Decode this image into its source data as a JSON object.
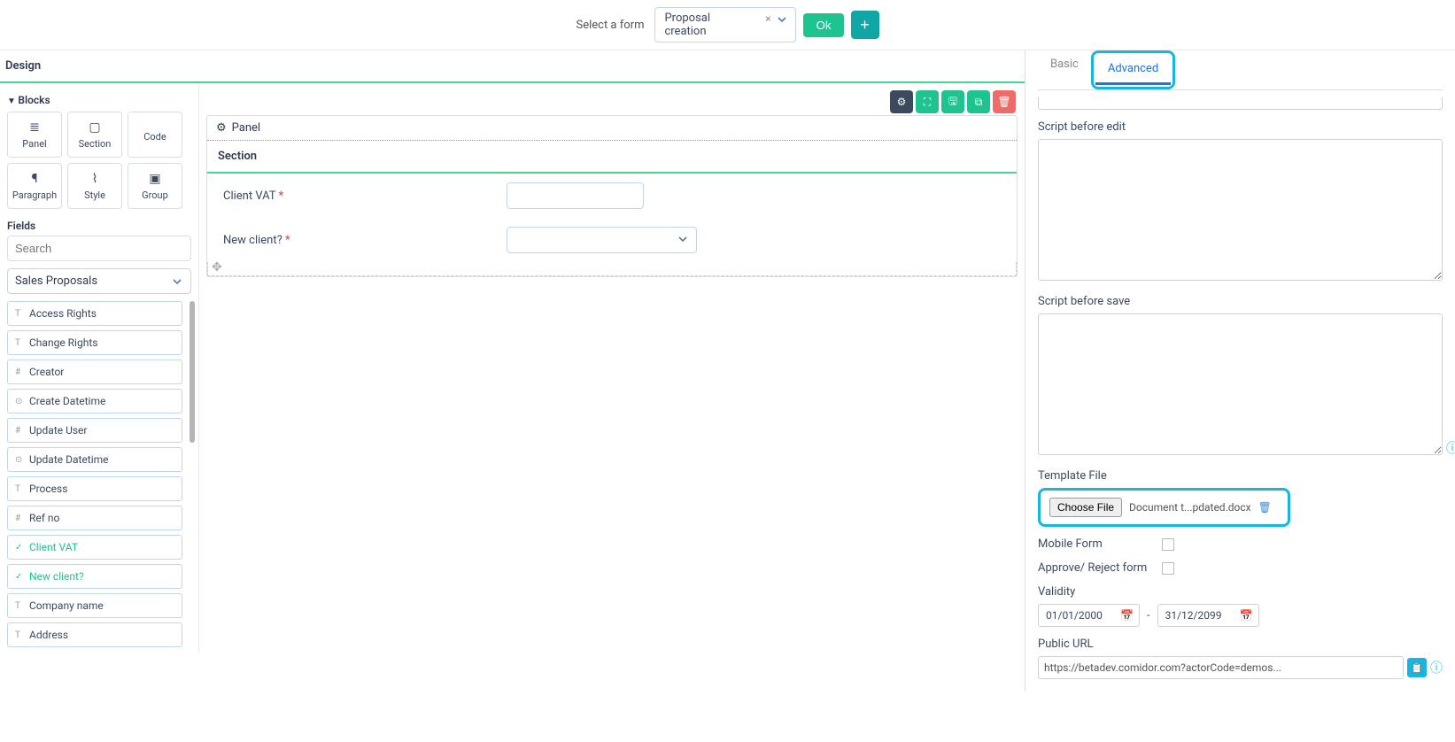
{
  "topbar": {
    "label": "Select a form",
    "selected": "Proposal creation",
    "ok": "Ok"
  },
  "design": {
    "title": "Design",
    "blocks_title": "Blocks",
    "blocks": [
      {
        "label": "Panel",
        "icon": "list-icon"
      },
      {
        "label": "Section",
        "icon": "square-icon"
      },
      {
        "label": "Code",
        "icon": "code-icon"
      },
      {
        "label": "Paragraph",
        "icon": "pilcrow-icon"
      },
      {
        "label": "Style",
        "icon": "style-icon"
      },
      {
        "label": "Group",
        "icon": "group-icon"
      }
    ],
    "fields_title": "Fields",
    "search_placeholder": "Search",
    "field_group": "Sales Proposals",
    "fields": [
      {
        "label": "Access Rights",
        "type": "T",
        "active": false
      },
      {
        "label": "Change Rights",
        "type": "T",
        "active": false
      },
      {
        "label": "Creator",
        "type": "#",
        "active": false
      },
      {
        "label": "Create Datetime",
        "type": "⊙",
        "active": false
      },
      {
        "label": "Update User",
        "type": "#",
        "active": false
      },
      {
        "label": "Update Datetime",
        "type": "⊙",
        "active": false
      },
      {
        "label": "Process",
        "type": "T",
        "active": false
      },
      {
        "label": "Ref no",
        "type": "#",
        "active": false
      },
      {
        "label": "Client VAT",
        "type": "✓",
        "active": true
      },
      {
        "label": "New client?",
        "type": "✓",
        "active": true
      },
      {
        "label": "Company name",
        "type": "T",
        "active": false
      },
      {
        "label": "Address",
        "type": "T",
        "active": false
      }
    ]
  },
  "canvas": {
    "panel_label": "Panel",
    "section_label": "Section",
    "rows": [
      {
        "label": "Client VAT",
        "required": true,
        "kind": "text"
      },
      {
        "label": "New client?",
        "required": true,
        "kind": "dropdown"
      }
    ]
  },
  "right": {
    "tab_basic": "Basic",
    "tab_advanced": "Advanced",
    "script_before_edit": "Script before edit",
    "script_before_save": "Script before save",
    "template_file": "Template File",
    "choose_file": "Choose File",
    "file_name": "Document t...pdated.docx",
    "mobile_form": "Mobile Form",
    "approve_reject": "Approve/ Reject form",
    "validity": "Validity",
    "date_from": "01/01/2000",
    "date_to": "31/12/2099",
    "date_sep": "-",
    "public_url": "Public URL",
    "url_value": "https://betadev.comidor.com?actorCode=demos..."
  }
}
